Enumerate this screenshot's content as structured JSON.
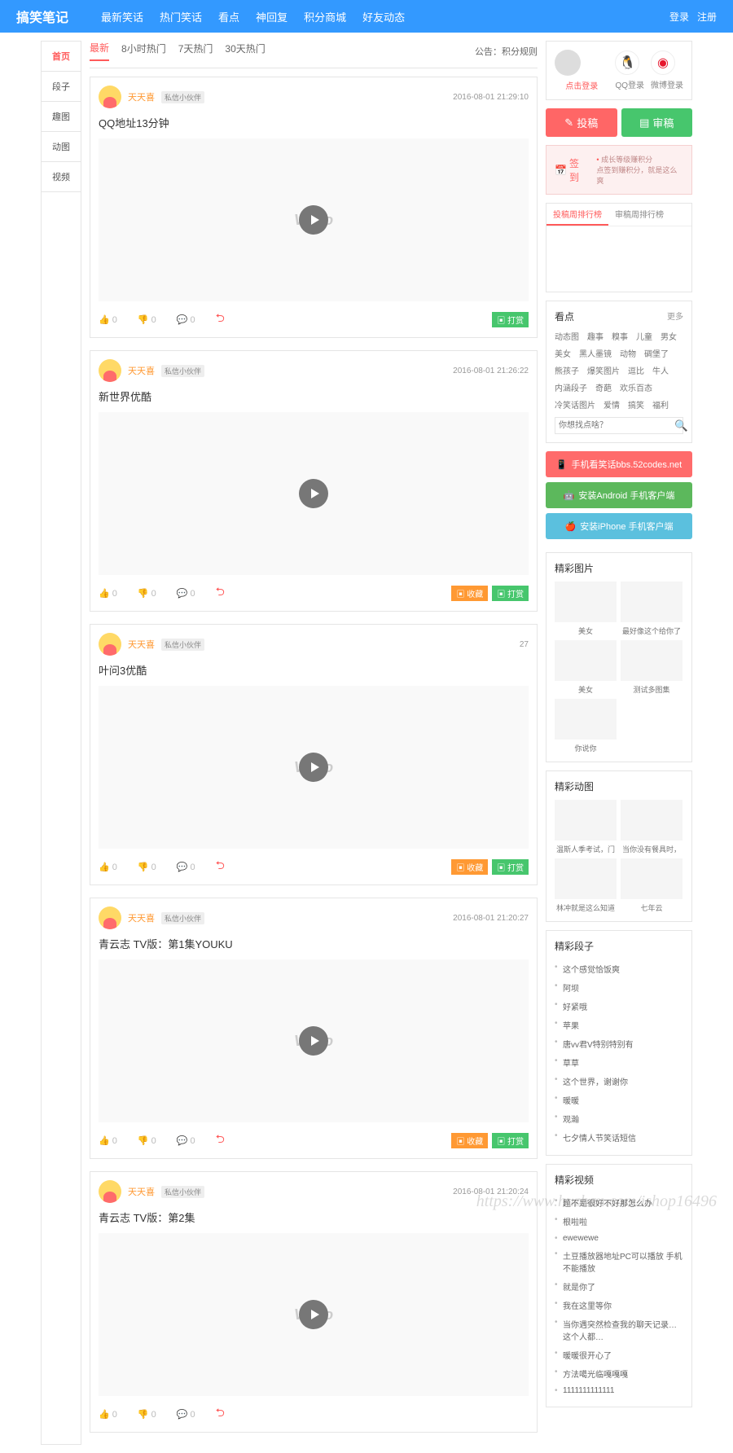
{
  "header": {
    "logo": "搞笑笔记",
    "nav": [
      "最新笑话",
      "热门笑话",
      "看点",
      "神回复",
      "积分商城",
      "好友动态"
    ],
    "login": "登录",
    "register": "注册"
  },
  "leftTabs": [
    "首页",
    "段子",
    "趣图",
    "动图",
    "视频"
  ],
  "topTabs": [
    "最新",
    "8小时热门",
    "7天热门",
    "30天热门"
  ],
  "notice": "公告：积分规则",
  "posts": [
    {
      "user": "天天喜",
      "badge": "私信小伙伴",
      "time": "2016-08-01 21:29:10",
      "title": "QQ地址13分钟",
      "watermark": "Video",
      "tags": [
        {
          "cls": "green",
          "t": "打赏"
        }
      ]
    },
    {
      "user": "天天喜",
      "badge": "私信小伙伴",
      "time": "2016-08-01 21:26:22",
      "title": "新世界优酷",
      "watermark": "",
      "tags": [
        {
          "cls": "orange",
          "t": "收藏"
        },
        {
          "cls": "green",
          "t": "打赏"
        }
      ]
    },
    {
      "user": "天天喜",
      "badge": "私信小伙伴",
      "time": "27",
      "title": "叶问3优酷",
      "watermark": "Video",
      "tags": [
        {
          "cls": "orange",
          "t": "收藏"
        },
        {
          "cls": "green",
          "t": "打赏"
        }
      ]
    },
    {
      "user": "天天喜",
      "badge": "私信小伙伴",
      "time": "2016-08-01 21:20:27",
      "title": "青云志 TV版：第1集YOUKU",
      "watermark": "Video",
      "tags": [
        {
          "cls": "orange",
          "t": "收藏"
        },
        {
          "cls": "green",
          "t": "打赏"
        }
      ]
    },
    {
      "user": "天天喜",
      "badge": "私信小伙伴",
      "time": "2016-08-01 21:20:24",
      "title": "青云志 TV版：第2集",
      "watermark": "Video",
      "tags": []
    }
  ],
  "actions": {
    "like": "0",
    "dislike": "0",
    "comment": "0"
  },
  "login": {
    "prompt": "点击登录",
    "qq": "QQ登录",
    "weibo": "微博登录"
  },
  "bigbtn": {
    "post": "投稿",
    "review": "审稿"
  },
  "signin": {
    "btn": "签到",
    "l1": "成长等级赚积分",
    "l2": "点签到赚积分，就是这么爽"
  },
  "rank": {
    "tab1": "投稿周排行榜",
    "tab2": "审稿周排行榜"
  },
  "kandian": {
    "title": "看点",
    "more": "更多",
    "tags": [
      "动态图",
      "趣事",
      "糗事",
      "儿童",
      "男女",
      "美女",
      "黑人墨镜",
      "动物",
      "碉堡了",
      "熊孩子",
      "爆笑图片",
      "逗比",
      "牛人",
      "内涵段子",
      "奇葩",
      "欢乐百态",
      "冷笑话图片",
      "爱情",
      "搞笑",
      "福利"
    ],
    "search": "你想找点啥？"
  },
  "apps": [
    {
      "cls": "red",
      "t": "手机看笑话bbs.52codes.net"
    },
    {
      "cls": "green",
      "t": "安装Android 手机客户端"
    },
    {
      "cls": "blue",
      "t": "安装iPhone 手机客户端"
    }
  ],
  "sections": {
    "pics": {
      "title": "精彩图片",
      "items": [
        "美女",
        "最好像这个给你了",
        "美女",
        "测试多图集",
        "你说你"
      ]
    },
    "gifs": {
      "title": "精彩动图",
      "items": [
        "温斯人季考试，门",
        "当你没有餐具时，",
        "林冲就是这么知道",
        "七年云"
      ]
    },
    "jokes": {
      "title": "精彩段子",
      "items": [
        "这个感觉恰饭爽",
        "阿坝",
        "好紧哦",
        "苹果",
        "唐vv君V特别特别有",
        "草草",
        "这个世界，谢谢你",
        "暖暖",
        "观瀚",
        "七夕情人节笑话短信"
      ]
    },
    "videos": {
      "title": "精彩视频",
      "items": [
        "题不是很好不好那怎么办",
        "根啦啦",
        "ewewewe",
        "土豆播放器地址PC可以播放 手机不能播放",
        "就是你了",
        "我在这里等你",
        "当你遇突然检查我的聊天记录…这个人都…",
        "暖暖很开心了",
        "方法噶光临嘎嘎嘎",
        "1111111111111"
      ]
    }
  },
  "watermark": "https://www.huzhan.com/ishop16496"
}
